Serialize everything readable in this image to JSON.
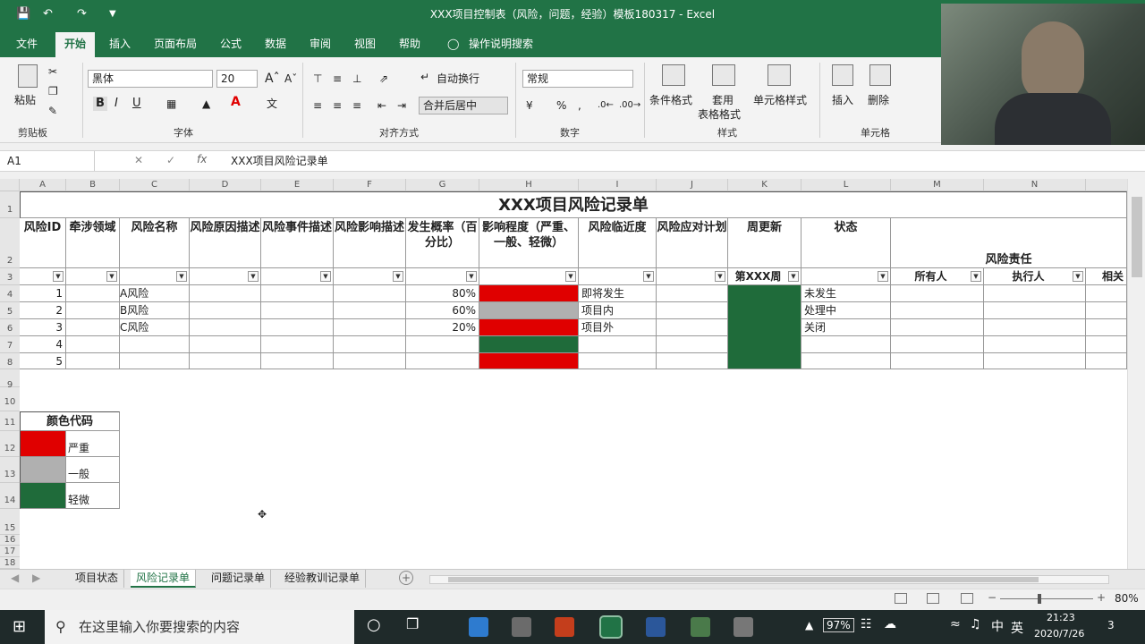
{
  "window": {
    "title": "XXX项目控制表（风险，问题，经验）模板180317  -  Excel"
  },
  "menu": {
    "items": [
      "文件",
      "开始",
      "插入",
      "页面布局",
      "公式",
      "数据",
      "审阅",
      "视图",
      "帮助"
    ],
    "active_index": 1,
    "tell_me": "操作说明搜索"
  },
  "ribbon": {
    "paste": "粘贴",
    "font_name": "黑体",
    "font_size": "20",
    "wrap_text": "自动换行",
    "merge_center": "合并后居中",
    "number_format": "常规",
    "conditional_format": "条件格式",
    "table_format_1": "套用",
    "table_format_2": "表格格式",
    "cell_styles": "单元格样式",
    "insert": "插入",
    "delete": "删除",
    "bold": "B",
    "italic": "I",
    "underline": "U",
    "percent": "%",
    "font_color_label": "A",
    "groups": {
      "clipboard": "剪贴板",
      "font": "字体",
      "alignment": "对齐方式",
      "number": "数字",
      "styles": "样式",
      "cells": "单元格"
    }
  },
  "formula_bar": {
    "name_box": "A1",
    "fx": "fx",
    "content": "XXX项目风险记录单"
  },
  "columns": [
    "A",
    "B",
    "C",
    "D",
    "E",
    "F",
    "G",
    "H",
    "I",
    "J",
    "K",
    "L",
    "M",
    "N"
  ],
  "rows": [
    "1",
    "2",
    "3",
    "4",
    "5",
    "6",
    "7",
    "8",
    "9",
    "10",
    "11",
    "12",
    "13",
    "14",
    "15",
    "16",
    "17",
    "18"
  ],
  "sheet": {
    "title": "XXX项目风险记录单",
    "headers": [
      "风险ID",
      "牵涉领域",
      "风险名称",
      "风险原因描述",
      "风险事件描述",
      "风险影响描述",
      "发生概率（百分比）",
      "影响程度（严重、一般、轻微）",
      "风险临近度",
      "风险应对计划",
      "周更新",
      "状态"
    ],
    "responsibility_header": "风险责任",
    "week_label": "第XXX周",
    "sub_headers": [
      "所有人",
      "执行人",
      "相关"
    ],
    "records": [
      {
        "id": "1",
        "name": "A风险",
        "prob": "80%",
        "impact": "严重",
        "proximity": "即将发生",
        "status": "未发生"
      },
      {
        "id": "2",
        "name": "B风险",
        "prob": "60%",
        "impact": "一般",
        "proximity": "项目内",
        "status": "处理中"
      },
      {
        "id": "3",
        "name": "C风险",
        "prob": "20%",
        "impact": "严重",
        "proximity": "项目外",
        "status": "关闭"
      },
      {
        "id": "4",
        "name": "",
        "prob": "",
        "impact": "轻微",
        "proximity": "",
        "status": ""
      },
      {
        "id": "5",
        "name": "",
        "prob": "",
        "impact": "严重",
        "proximity": "",
        "status": ""
      }
    ]
  },
  "legend": {
    "title": "颜色代码",
    "items": [
      {
        "label": "严重",
        "color": "#e00000"
      },
      {
        "label": "一般",
        "color": "#b0b0b0"
      },
      {
        "label": "轻微",
        "color": "#1f6b3a"
      }
    ]
  },
  "sheet_tabs": [
    "项目状态",
    "风险记录单",
    "问题记录单",
    "经验教训记录单"
  ],
  "active_tab_index": 1,
  "status": {
    "zoom": "80%"
  },
  "taskbar": {
    "search_placeholder": "在这里输入你要搜索的内容",
    "battery": "97%",
    "ime": "英",
    "time": "21:23",
    "date": "2020/7/26",
    "notif_count": "3"
  },
  "colors": {
    "excel_green": "#217346",
    "severe_red": "#e00000",
    "medium_gray": "#b0b0b0",
    "minor_green": "#1f6b3a"
  }
}
